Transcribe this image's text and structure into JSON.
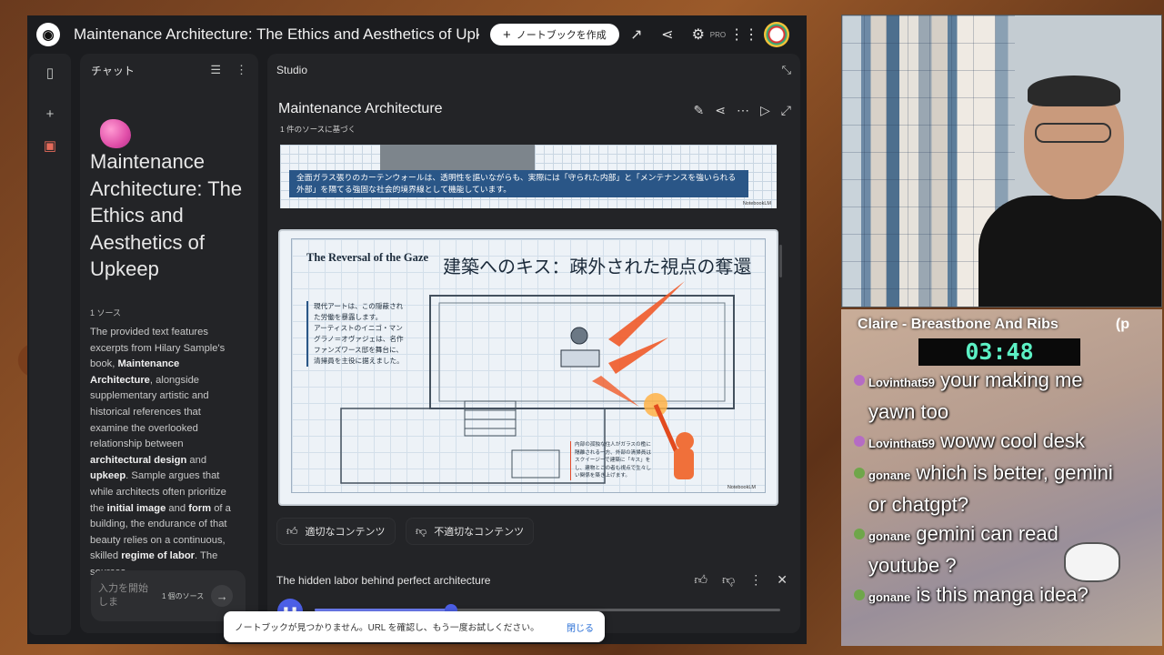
{
  "app": {
    "logo": "notebooklm-logo",
    "title": "Maintenance Architecture: The Ethics and Aesthetics of Upke",
    "create_button": "ノートブックを作成",
    "pro_label": "PRO"
  },
  "chat_panel": {
    "header": "チャット",
    "doc_title": "Maintenance Architecture: The Ethics and Aesthetics of Upkeep",
    "source_count": "1 ソース",
    "summary_parts": [
      "The provided text features excerpts from Hilary Sample's book, ",
      "Maintenance Architecture",
      ", alongside supplementary artistic and historical references that examine the overlooked relationship between ",
      "architectural design",
      " and ",
      "upkeep",
      ". Sample argues that while architects often prioritize the ",
      "initial image",
      " and ",
      "form",
      " of a building, the endurance of that beauty relies on a continuous, skilled ",
      "regime of labor",
      ". The sources"
    ],
    "input_placeholder": "入力を開始しま",
    "input_source_count": "1 個のソース"
  },
  "studio": {
    "header": "Studio",
    "title": "Maintenance Architecture",
    "subtitle": "1 件のソースに基づく",
    "slide1": {
      "caption": "全面ガラス張りのカーテンウォールは、透明性を謳いながらも、実際には「守られた内部」と「メンテナンスを強いられる外部」を隔てる強固な社会的境界線として機能しています。",
      "watermark": "NotebookLM"
    },
    "slide2": {
      "title_en": "The Reversal of the Gaze",
      "title_jp": "建築へのキス：疎外された視点の奪還",
      "text_1": "現代アートは、この隠蔽された労働を暴露します。",
      "text_2": "アーティストのイニゴ・マングラノ＝オヴァジェは、名作ファンズワース邸を舞台に、清掃員を主役に据えました。",
      "note": "内部の孤独な住人がガラスの檻に隔離される一方、外部の清掃員はスクイージーで建築に「キス」をし、建物とこの者も視点で生々しい関係を築き上げます。",
      "watermark": "NotebookLM"
    },
    "feedback_good": "適切なコンテンツ",
    "feedback_bad": "不適切なコンテンツ",
    "audio": {
      "title": "The hidden labor behind perfect architecture",
      "progress_fraction": 0.293
    }
  },
  "toast": {
    "message": "ノートブックが見つかりません。URL を確認し、もう一度お試しください。",
    "close": "閉じる"
  },
  "stream": {
    "song": "Claire - Breastbone And Ribs",
    "song_extra": "(p",
    "timer": "03:48",
    "messages": [
      {
        "user": "Lovinthat59",
        "text": " your making me yawn too",
        "badge_color": "#b56cc4"
      },
      {
        "user": "Lovinthat59",
        "text": " woww cool desk",
        "badge_color": "#b56cc4"
      },
      {
        "user": "gonane",
        "text": " which is better, gemini or chatgpt?",
        "badge_color": "#6fa64a"
      },
      {
        "user": "gonane",
        "text": " gemini can read youtube ?",
        "badge_color": "#6fa64a"
      },
      {
        "user": "gonane",
        "text": " is this manga idea?",
        "badge_color": "#6fa64a"
      }
    ]
  },
  "colors": {
    "accent": "#4c5fe6",
    "panel_bg": "#232427",
    "app_bg": "#1b1c1f",
    "timer_text": "#5cf0c4"
  }
}
